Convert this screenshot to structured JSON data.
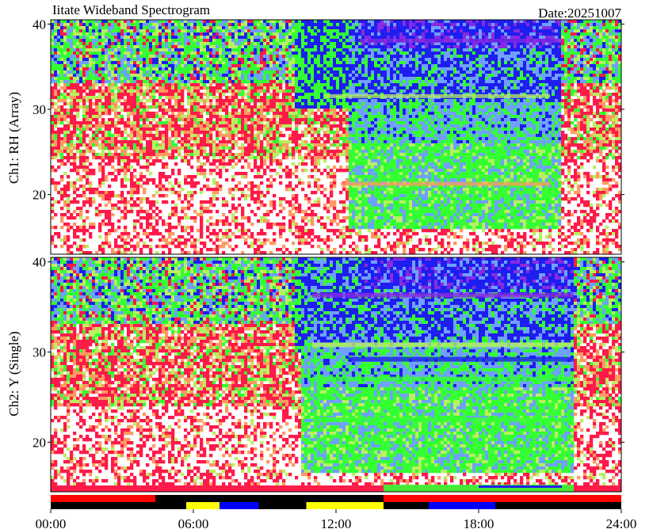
{
  "chart_data": {
    "type": "heatmap",
    "title": "Iitate Wideband Spectrogram",
    "date_label": "Date:20251007",
    "x": {
      "range_hours": [
        0,
        24
      ],
      "tick_labels": [
        "00:00",
        "06:00",
        "12:00",
        "18:00",
        "24:00"
      ],
      "tick_values_hours": [
        0,
        6,
        12,
        18,
        24
      ]
    },
    "panels": [
      {
        "name": "Ch1: RH (Array)",
        "ylim": [
          13,
          40.5
        ],
        "yticks": [
          20,
          30,
          40
        ],
        "quiet_band_hours": [
          12.5,
          21.5
        ],
        "quiet_onset_hours": [
          10.2,
          12.7
        ]
      },
      {
        "name": "Ch2: Y (Single)",
        "ylim": [
          14.5,
          40.5
        ],
        "yticks": [
          20,
          30,
          40
        ],
        "quiet_band_hours": [
          10.5,
          22.0
        ],
        "quiet_onset_hours": [
          10.3,
          10.6
        ]
      }
    ],
    "colors": {
      "white": "#ffffff",
      "red": "#ff1a4a",
      "orange": "#ff9a60",
      "yellowgreen": "#b8f060",
      "green": "#33ff33",
      "lightblue": "#6fa0ff",
      "blue": "#1e1ef0",
      "purple": "#8a2ae0"
    },
    "status_bars": [
      {
        "row": "top",
        "start": 0.0,
        "end": 4.4,
        "color": "#ff0000"
      },
      {
        "row": "top",
        "start": 4.4,
        "end": 14.0,
        "color": "#000000"
      },
      {
        "row": "top",
        "start": 14.0,
        "end": 24.0,
        "color": "#ff0000"
      },
      {
        "row": "bottom",
        "start": 0.0,
        "end": 5.7,
        "color": "#000000"
      },
      {
        "row": "bottom",
        "start": 5.7,
        "end": 7.1,
        "color": "#ffff00"
      },
      {
        "row": "bottom",
        "start": 7.1,
        "end": 8.75,
        "color": "#0000ff"
      },
      {
        "row": "bottom",
        "start": 8.75,
        "end": 10.75,
        "color": "#000000"
      },
      {
        "row": "bottom",
        "start": 10.75,
        "end": 14.0,
        "color": "#ffff00"
      },
      {
        "row": "bottom",
        "start": 14.0,
        "end": 15.9,
        "color": "#000000"
      },
      {
        "row": "bottom",
        "start": 15.9,
        "end": 18.7,
        "color": "#0000ff"
      },
      {
        "row": "bottom",
        "start": 18.7,
        "end": 24.0,
        "color": "#000000"
      }
    ]
  }
}
